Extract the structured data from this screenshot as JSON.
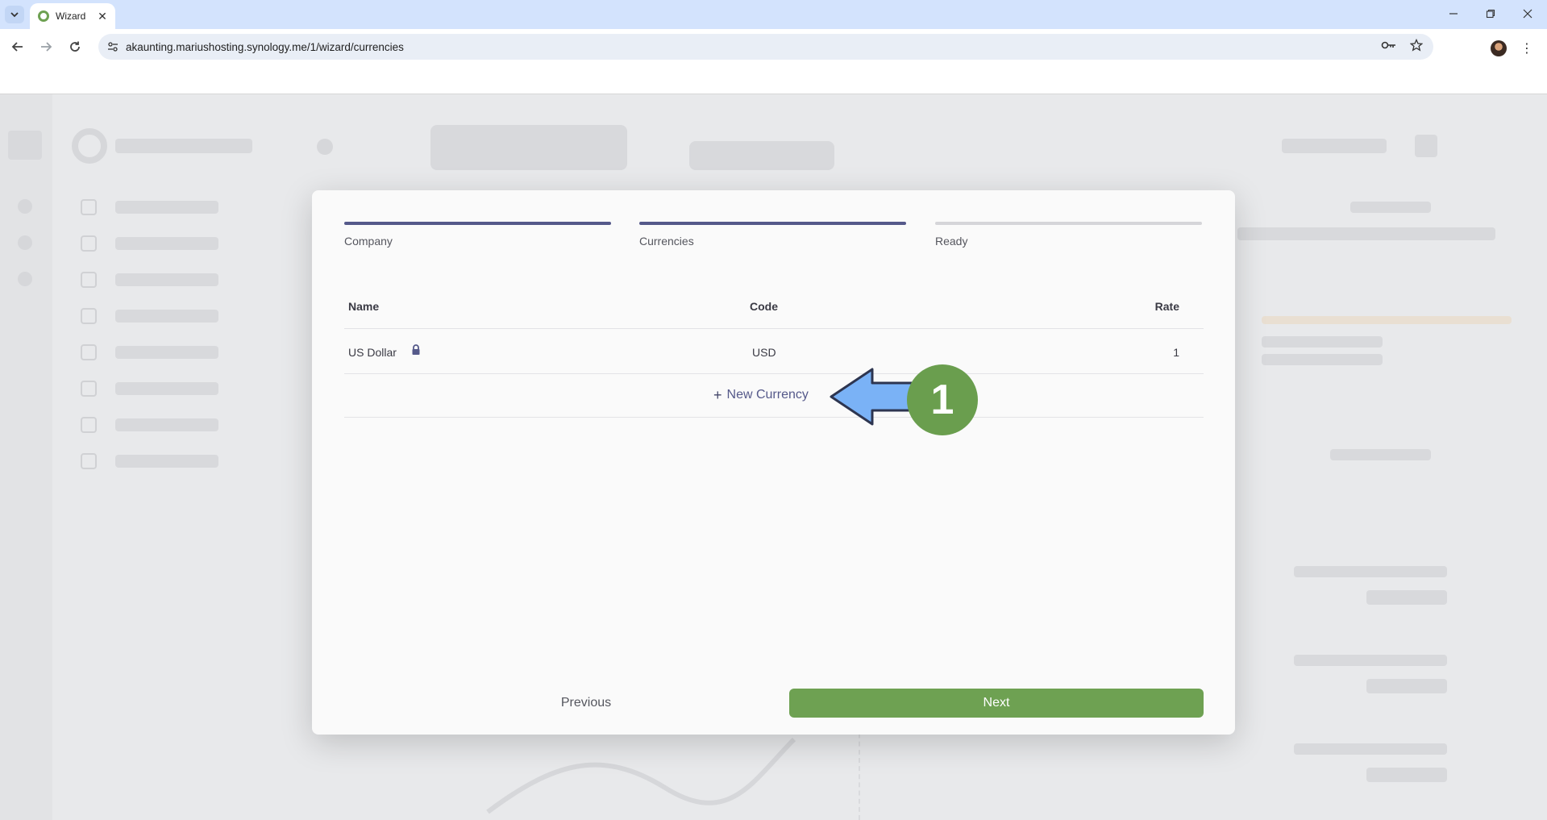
{
  "browser": {
    "tab_title": "Wizard",
    "url": "akaunting.mariushosting.synology.me/1/wizard/currencies"
  },
  "wizard": {
    "steps": [
      {
        "label": "Company",
        "state": "complete"
      },
      {
        "label": "Currencies",
        "state": "active"
      },
      {
        "label": "Ready",
        "state": "pending"
      }
    ],
    "table": {
      "headers": {
        "name": "Name",
        "code": "Code",
        "rate": "Rate"
      },
      "rows": [
        {
          "name": "US Dollar",
          "code": "USD",
          "rate": "1",
          "locked": true
        }
      ]
    },
    "new_currency_label": "New Currency",
    "previous_label": "Previous",
    "next_label": "Next"
  },
  "annotation": {
    "number": "1"
  },
  "colors": {
    "accent": "#6ea152",
    "step_done": "#55598a",
    "step_pending": "#d5d5d9",
    "arrow": "#7ab2f6",
    "badge": "#6a9e4e"
  }
}
